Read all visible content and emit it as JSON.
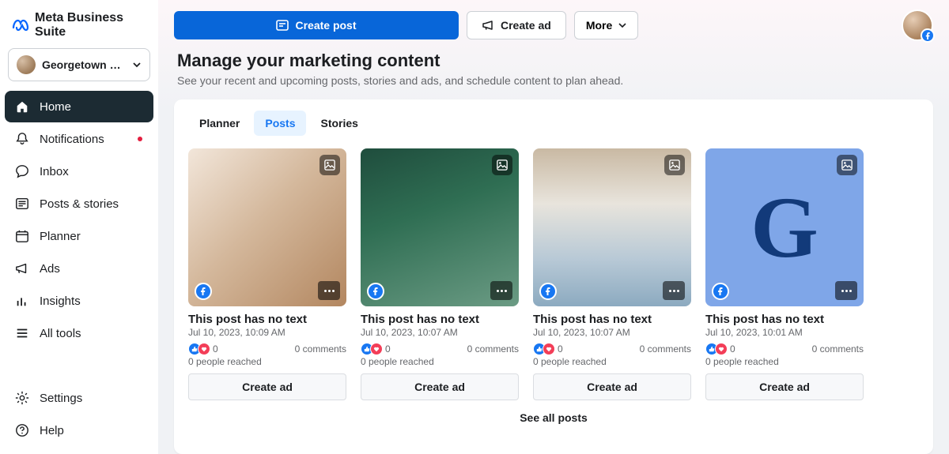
{
  "brand": {
    "name": "Meta\nBusiness Suite"
  },
  "account": {
    "name": "Georgetown Real…"
  },
  "sidebar": {
    "items": [
      {
        "label": "Home",
        "icon": "home-icon",
        "active": true
      },
      {
        "label": "Notifications",
        "icon": "bell-icon",
        "dot": true
      },
      {
        "label": "Inbox",
        "icon": "chat-icon"
      },
      {
        "label": "Posts & stories",
        "icon": "posts-icon"
      },
      {
        "label": "Planner",
        "icon": "calendar-icon"
      },
      {
        "label": "Ads",
        "icon": "megaphone-icon"
      },
      {
        "label": "Insights",
        "icon": "chart-icon"
      },
      {
        "label": "All tools",
        "icon": "menu-icon"
      }
    ],
    "footer": [
      {
        "label": "Settings",
        "icon": "gear-icon"
      },
      {
        "label": "Help",
        "icon": "help-icon"
      }
    ]
  },
  "topbar": {
    "create_post": "Create post",
    "create_ad": "Create ad",
    "more": "More"
  },
  "section": {
    "title": "Manage your marketing content",
    "subtitle": "See your recent and upcoming posts, stories and ads, and schedule content to plan ahead."
  },
  "tabs": [
    {
      "label": "Planner"
    },
    {
      "label": "Posts",
      "active": true
    },
    {
      "label": "Stories"
    }
  ],
  "posts": [
    {
      "title": "This post has no text",
      "date": "Jul 10, 2023, 10:09 AM",
      "reactions": 0,
      "comments_text": "0 comments",
      "reach_text": "0 people reached",
      "create_ad_label": "Create ad",
      "thumb_class": "thumb-0"
    },
    {
      "title": "This post has no text",
      "date": "Jul 10, 2023, 10:07 AM",
      "reactions": 0,
      "comments_text": "0 comments",
      "reach_text": "0 people reached",
      "create_ad_label": "Create ad",
      "thumb_class": "thumb-1"
    },
    {
      "title": "This post has no text",
      "date": "Jul 10, 2023, 10:07 AM",
      "reactions": 0,
      "comments_text": "0 comments",
      "reach_text": "0 people reached",
      "create_ad_label": "Create ad",
      "thumb_class": "thumb-2"
    },
    {
      "title": "This post has no text",
      "date": "Jul 10, 2023, 10:01 AM",
      "reactions": 0,
      "comments_text": "0 comments",
      "reach_text": "0 people reached",
      "create_ad_label": "Create ad",
      "thumb_class": "thumb-3",
      "letter": "G"
    }
  ],
  "see_all": "See all posts"
}
